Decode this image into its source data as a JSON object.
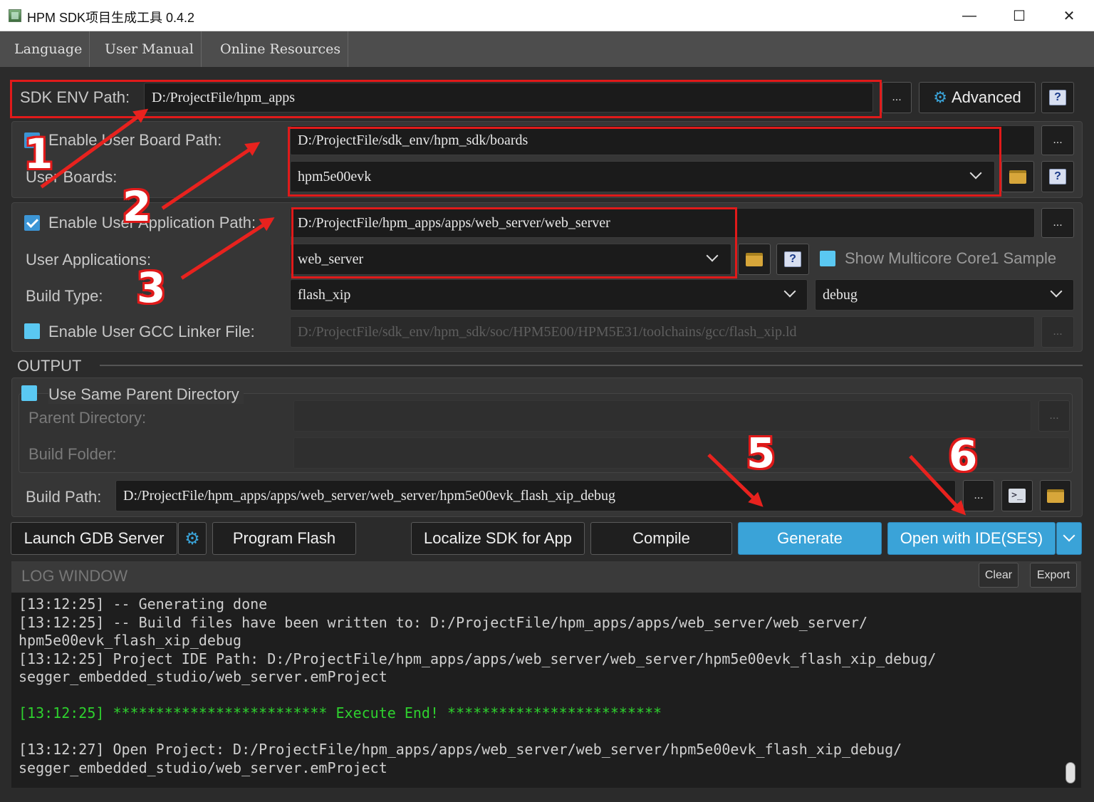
{
  "window": {
    "title": "HPM SDK项目生成工具 0.4.2",
    "min": "—",
    "max": "☐",
    "close": "✕"
  },
  "menu": [
    "Language",
    "User Manual",
    "Online Resources"
  ],
  "sdk_env": {
    "label": "SDK ENV Path:",
    "value": "D:/ProjectFile/hpm_apps",
    "browse": "...",
    "advanced": "Advanced",
    "help": "?"
  },
  "board": {
    "enable_label": "Enable User Board Path:",
    "enabled": true,
    "path": "D:/ProjectFile/sdk_env/hpm_sdk/boards",
    "browse": "...",
    "boards_label": "User Boards:",
    "board_value": "hpm5e00evk",
    "help": "?"
  },
  "app": {
    "enable_label": "Enable User Application Path:",
    "enabled": true,
    "path": "D:/ProjectFile/hpm_apps/apps/web_server/web_server",
    "browse": "...",
    "apps_label": "User Applications:",
    "app_value": "web_server",
    "help": "?",
    "multicore_label": "Show Multicore Core1 Sample",
    "multicore": false,
    "build_type_label": "Build Type:",
    "build_type": "flash_xip",
    "build_config": "debug",
    "linker_label": "Enable User GCC Linker File:",
    "linker_enabled": false,
    "linker_path": "D:/ProjectFile/sdk_env/hpm_sdk/soc/HPM5E00/HPM5E31/toolchains/gcc/flash_xip.ld",
    "linker_browse": "..."
  },
  "output": {
    "section_title": "OUTPUT",
    "same_parent_label": "Use Same Parent Directory",
    "same_parent": false,
    "parent_dir_label": "Parent Directory:",
    "parent_dir": "",
    "parent_browse": "...",
    "build_folder_label": "Build Folder:",
    "build_folder": "",
    "build_path_label": "Build Path:",
    "build_path": "D:/ProjectFile/hpm_apps/apps/web_server/web_server/hpm5e00evk_flash_xip_debug",
    "build_path_browse": "..."
  },
  "actions": {
    "launch_gdb": "Launch GDB Server",
    "program_flash": "Program Flash",
    "localize": "Localize SDK for App",
    "compile": "Compile",
    "generate": "Generate",
    "open_ide": "Open with IDE(SES)"
  },
  "log": {
    "title": "LOG WINDOW",
    "clear": "Clear",
    "export": "Export",
    "lines": [
      {
        "text": "[13:12:25] -- Generating done",
        "color": "normal"
      },
      {
        "text": "[13:12:25] -- Build files have been written to: D:/ProjectFile/hpm_apps/apps/web_server/web_server/",
        "color": "normal"
      },
      {
        "text": "hpm5e00evk_flash_xip_debug",
        "color": "normal"
      },
      {
        "text": "[13:12:25] Project IDE Path: D:/ProjectFile/hpm_apps/apps/web_server/web_server/hpm5e00evk_flash_xip_debug/",
        "color": "normal"
      },
      {
        "text": "segger_embedded_studio/web_server.emProject",
        "color": "normal"
      },
      {
        "text": "",
        "color": "normal"
      },
      {
        "text": "[13:12:25] ************************* Execute End! *************************",
        "color": "green"
      },
      {
        "text": "",
        "color": "normal"
      },
      {
        "text": "[13:12:27] Open Project: D:/ProjectFile/hpm_apps/apps/web_server/web_server/hpm5e00evk_flash_xip_debug/",
        "color": "normal"
      },
      {
        "text": "segger_embedded_studio/web_server.emProject",
        "color": "normal"
      }
    ]
  },
  "annotations": [
    "1",
    "2",
    "3",
    "5",
    "6"
  ],
  "colors": {
    "accent": "#3aa3d8",
    "highlight": "#e01a1a",
    "log_green": "#2ed12e",
    "background": "#2b2b2b"
  }
}
